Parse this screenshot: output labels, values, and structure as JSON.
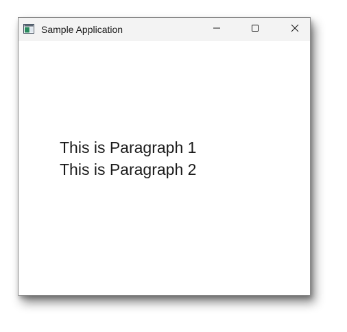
{
  "window": {
    "title": "Sample Application",
    "app_icon": "window-app-icon",
    "caption_buttons": {
      "minimize": "minimize-icon",
      "maximize": "maximize-icon",
      "close": "close-icon"
    }
  },
  "content": {
    "paragraphs": [
      "This is Paragraph 1",
      "This is Paragraph 2"
    ]
  },
  "colors": {
    "titlebar_bg": "#f3f3f3",
    "client_bg": "#ffffff",
    "text": "#1a1a1a"
  }
}
